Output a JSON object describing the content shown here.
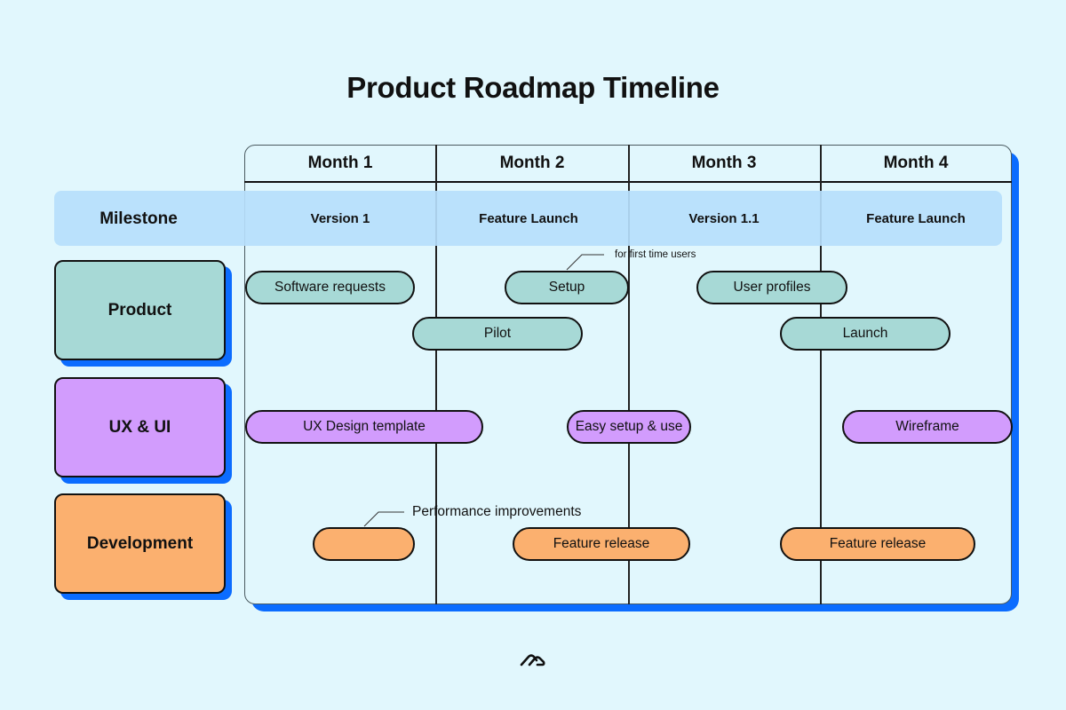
{
  "title": "Product Roadmap Timeline",
  "months": [
    "Month 1",
    "Month 2",
    "Month 3",
    "Month 4"
  ],
  "milestone": {
    "label": "Milestone",
    "values": [
      "Version 1",
      "Feature Launch",
      "Version 1.1",
      "Feature Launch"
    ]
  },
  "categories": [
    {
      "label": "Product",
      "color": "#a7d9d6"
    },
    {
      "label": "UX & UI",
      "color": "#d29cfd"
    },
    {
      "label": "Development",
      "color": "#fbb06f"
    }
  ],
  "tasks": {
    "product": [
      "Software requests",
      "Setup",
      "User profiles",
      "Pilot",
      "Launch"
    ],
    "ux": [
      "UX Design template",
      "Easy setup & use",
      "Wireframe"
    ],
    "dev": [
      "",
      "Feature release",
      "Feature release"
    ]
  },
  "annotations": {
    "setup_note": "for first time users",
    "dev_note": "Performance improvements"
  },
  "colors": {
    "background": "#e1f7fd",
    "shadow": "#0b6cff",
    "milestone_band": "#b6defc"
  },
  "logo_icon": "brand-logo-icon"
}
